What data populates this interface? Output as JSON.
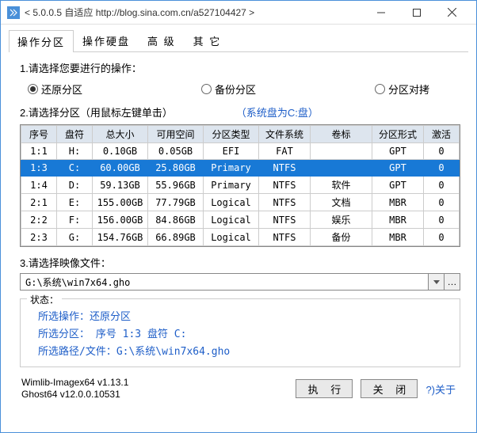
{
  "titlebar": {
    "text": "< 5.0.0.5 自适应 http://blog.sina.com.cn/a527104427 >"
  },
  "tabs": [
    {
      "label": "操作分区",
      "active": true
    },
    {
      "label": "操作硬盘",
      "active": false
    },
    {
      "label": "高 级",
      "active": false
    },
    {
      "label": "其 它",
      "active": false
    }
  ],
  "section1": {
    "title": "1.请选择您要进行的操作：",
    "options": [
      {
        "label": "还原分区",
        "checked": true
      },
      {
        "label": "备份分区",
        "checked": false
      },
      {
        "label": "分区对拷",
        "checked": false
      }
    ]
  },
  "section2": {
    "title": "2.请选择分区（用鼠标左键单击）",
    "tip": "（系统盘为C:盘）",
    "headers": [
      "序号",
      "盘符",
      "总大小",
      "可用空间",
      "分区类型",
      "文件系统",
      "卷标",
      "分区形式",
      "激活"
    ],
    "rows": [
      {
        "seq": "1:1",
        "drive": "H:",
        "total": "0.10GB",
        "free": "0.05GB",
        "ptype": "EFI",
        "fs": "FAT",
        "vol": "",
        "pf": "GPT",
        "act": "0",
        "sel": false
      },
      {
        "seq": "1:3",
        "drive": "C:",
        "total": "60.00GB",
        "free": "25.80GB",
        "ptype": "Primary",
        "fs": "NTFS",
        "vol": "",
        "pf": "GPT",
        "act": "0",
        "sel": true
      },
      {
        "seq": "1:4",
        "drive": "D:",
        "total": "59.13GB",
        "free": "55.96GB",
        "ptype": "Primary",
        "fs": "NTFS",
        "vol": "软件",
        "pf": "GPT",
        "act": "0",
        "sel": false
      },
      {
        "seq": "2:1",
        "drive": "E:",
        "total": "155.00GB",
        "free": "77.79GB",
        "ptype": "Logical",
        "fs": "NTFS",
        "vol": "文档",
        "pf": "MBR",
        "act": "0",
        "sel": false
      },
      {
        "seq": "2:2",
        "drive": "F:",
        "total": "156.00GB",
        "free": "84.86GB",
        "ptype": "Logical",
        "fs": "NTFS",
        "vol": "娱乐",
        "pf": "MBR",
        "act": "0",
        "sel": false
      },
      {
        "seq": "2:3",
        "drive": "G:",
        "total": "154.76GB",
        "free": "66.89GB",
        "ptype": "Logical",
        "fs": "NTFS",
        "vol": "备份",
        "pf": "MBR",
        "act": "0",
        "sel": false
      }
    ]
  },
  "section3": {
    "title": "3.请选择映像文件：",
    "value": "G:\\系统\\win7x64.gho"
  },
  "status": {
    "label": "状态：",
    "lines": [
      "所选操作：还原分区",
      "所选分区：  序号 1:3        盘符 C:",
      "所选路径/文件：G:\\系统\\win7x64.gho"
    ]
  },
  "footer": {
    "ver1": "Wimlib-Imagex64 v1.13.1",
    "ver2": "Ghost64 v12.0.0.10531",
    "exec": "执 行",
    "close": "关 闭",
    "about": "?)关于"
  }
}
